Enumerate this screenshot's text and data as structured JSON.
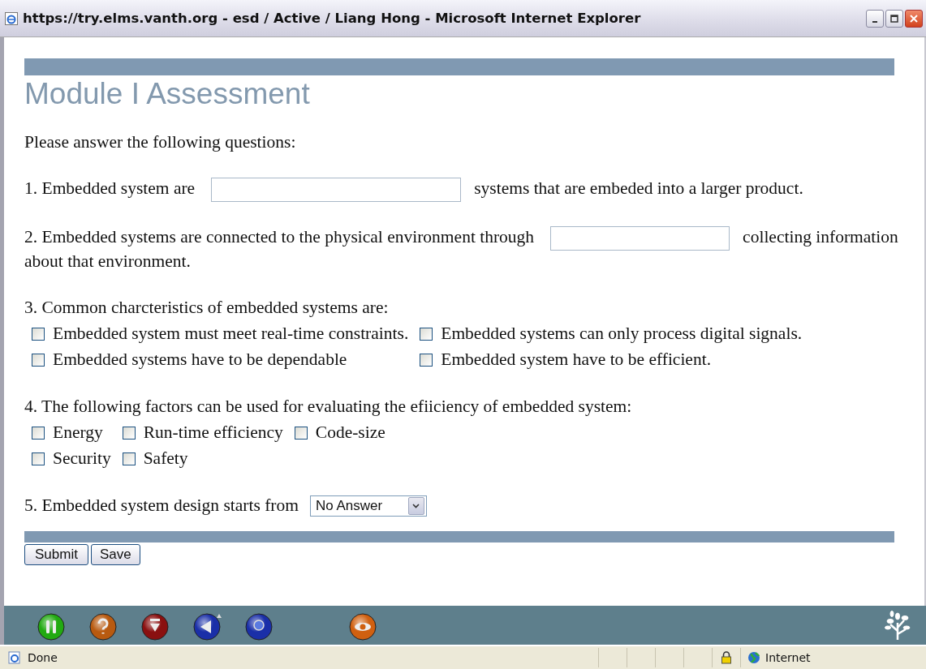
{
  "window": {
    "title": "https://try.elms.vanth.org - esd / Active / Liang Hong - Microsoft Internet Explorer"
  },
  "page": {
    "heading": "Module I Assessment",
    "intro": "Please answer the following questions:",
    "questions": [
      {
        "kind": "fill_in",
        "before": "1. Embedded system are",
        "after": [
          "systems that are embeded into a larger product."
        ]
      },
      {
        "kind": "fill_in",
        "before": "2. Embedded systems are connected to the physical environment through",
        "after": [
          "collecting information",
          "about that environment."
        ]
      },
      {
        "kind": "checklist",
        "text": "3. Common charcteristics of embedded systems are:",
        "rows": [
          [
            {
              "label": "Embedded system must meet real-time constraints.",
              "checked": false
            },
            {
              "label": "Embedded systems can only process digital signals.",
              "checked": false
            }
          ],
          [
            {
              "label": "Embedded systems have to be dependable",
              "checked": false
            },
            {
              "label": "Embedded system have to be efficient.",
              "checked": false
            }
          ]
        ]
      },
      {
        "kind": "checklist",
        "text": "4. The following factors can be used for evaluating the efiiciency of embedded system:",
        "rows": [
          [
            {
              "label": "Energy",
              "checked": false
            },
            {
              "label": "Run-time efficiency",
              "checked": false
            },
            {
              "label": "Code-size",
              "checked": false
            }
          ],
          [
            {
              "label": "Security",
              "checked": false
            },
            {
              "label": "Safety",
              "checked": false
            }
          ]
        ]
      },
      {
        "kind": "select",
        "text": "5. Embedded system design starts from",
        "value": "No Answer"
      }
    ],
    "buttons": [
      "Submit",
      "Save"
    ]
  },
  "toolbar": [
    {
      "kind": "pause",
      "color": "#22aa11"
    },
    {
      "kind": "help",
      "color": "#b85a10"
    },
    {
      "kind": "down",
      "color": "#8a1010"
    },
    {
      "kind": "back",
      "color": "#1a2fa8"
    },
    {
      "kind": "stop",
      "color": "#1a2fa8"
    },
    {
      "kind": "eye",
      "color": "#d06010"
    }
  ],
  "status_bar": {
    "text": "Done",
    "zone": "Internet"
  }
}
